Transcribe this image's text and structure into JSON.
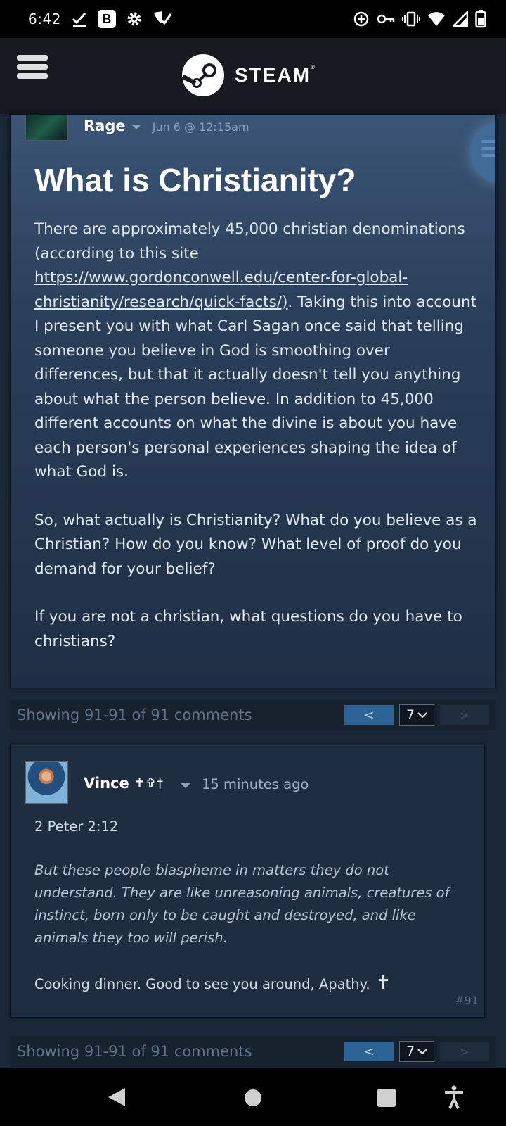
{
  "status_bar": {
    "time": "6:42",
    "badge_letter": "B",
    "left_icons": [
      "check-download-icon",
      "b-app-icon",
      "gear-icon",
      "shield-check-icon"
    ],
    "right_icons": [
      "data-saver-icon",
      "vpn-key-icon",
      "vibrate-icon",
      "wifi-icon",
      "signal-icon",
      "battery-icon"
    ]
  },
  "header": {
    "brand": "STEAM",
    "trademark": "®"
  },
  "post": {
    "author": "Rage",
    "date": "Jun 6 @ 12:15am",
    "title": "What is Christianity?",
    "p1_before": "There are approximately 45,000 christian denominations (according to this site ",
    "p1_link": "https://www.gordonconwell.edu/center-for-global-christianity/research/quick-facts/)",
    "p1_after": ". Taking this into account I present you with what Carl Sagan once said that telling someone you believe in God is smoothing over differences, but that it actually doesn't tell you anything about what the person believe. In addition to 45,000 different accounts on what the divine is about you have each person's personal experiences shaping the idea of what God is.",
    "p2": "So, what actually is Christianity? What do you believe as a Christian? How do you know? What level of proof do you demand for your belief?",
    "p3": "If you are not a christian, what questions do you have to christians?"
  },
  "pager": {
    "text": "Showing 91-91 of 91 comments",
    "prev": "<",
    "page": "7",
    "next": ">"
  },
  "comment": {
    "author": "Vince",
    "author_symbols": "✝✞†",
    "time": "15 minutes ago",
    "reference": "2 Peter 2:12",
    "quote": "But these people blaspheme in matters they do not understand. They are like unreasoning animals, creatures of instinct, born only to be caught and destroyed, and like animals they too will perish.",
    "message": "Cooking dinner. Good to see you around, Apathy.",
    "emoji": "✝",
    "number": "#91"
  },
  "nav": {
    "icons": [
      "back-icon",
      "home-icon",
      "recents-icon",
      "accessibility-icon"
    ]
  }
}
